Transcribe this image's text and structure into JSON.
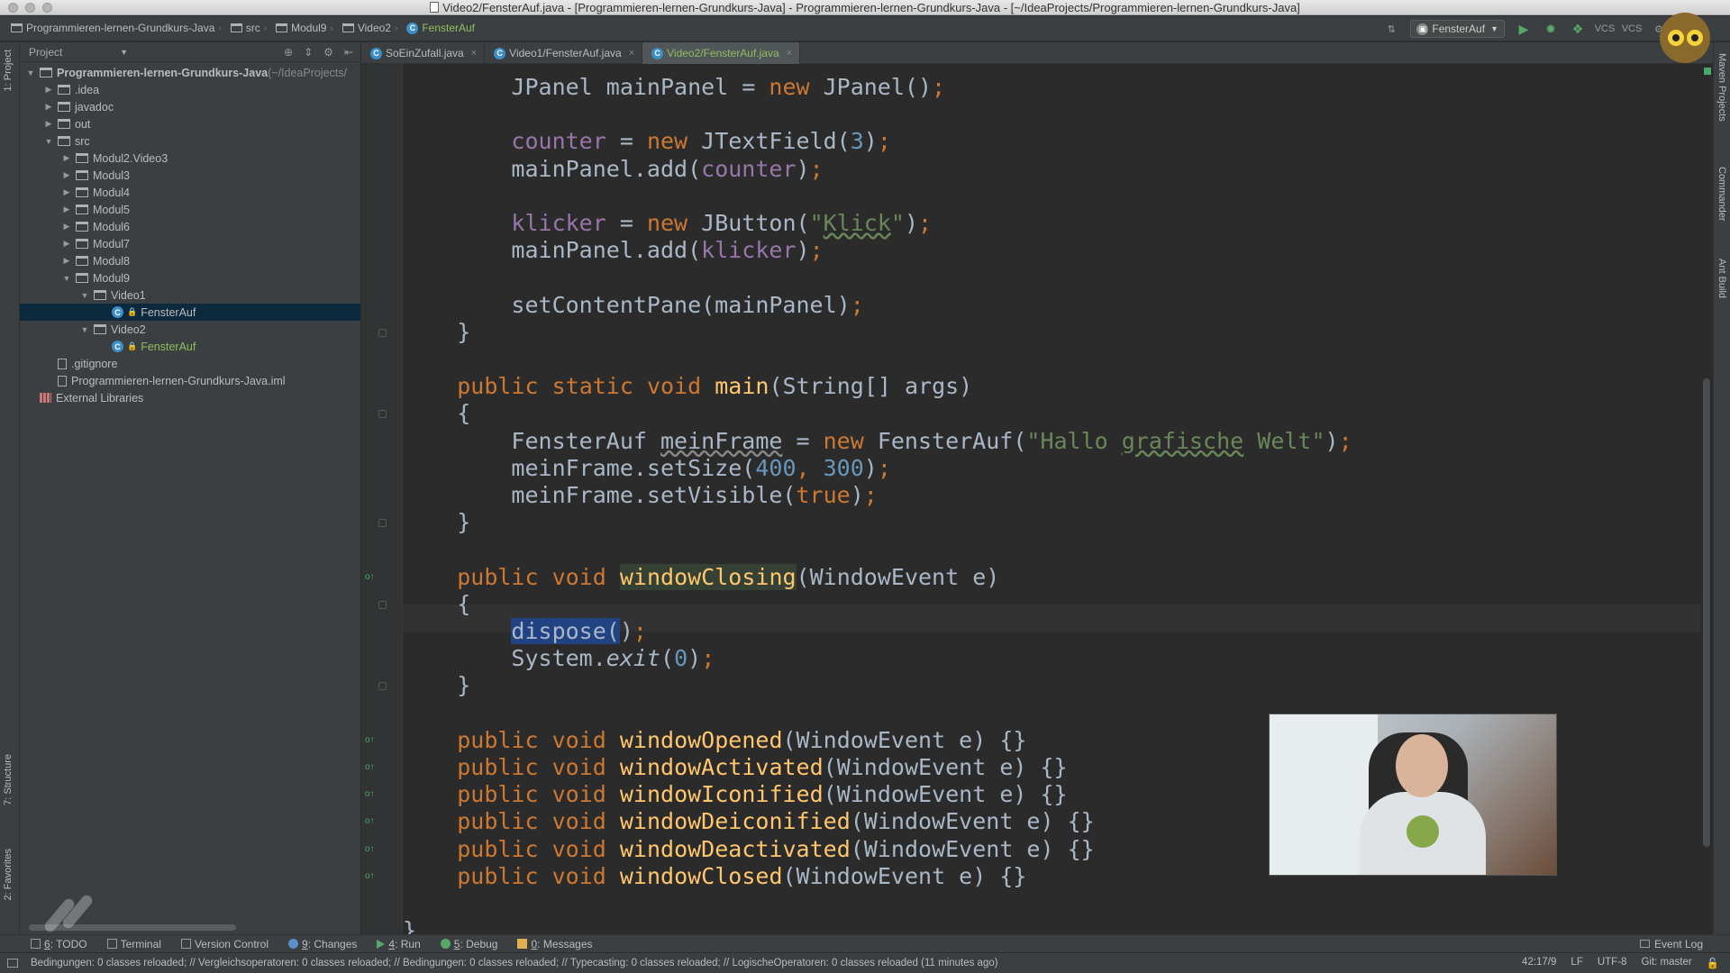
{
  "window": {
    "title": "Video2/FensterAuf.java - [Programmieren-lernen-Grundkurs-Java] - Programmieren-lernen-Grundkurs-Java - [~/IdeaProjects/Programmieren-lernen-Grundkurs-Java]"
  },
  "breadcrumbs": [
    "Programmieren-lernen-Grundkurs-Java",
    "src",
    "Modul9",
    "Video2",
    "FensterAuf"
  ],
  "toolbar": {
    "run_config": "FensterAuf",
    "vcs1": "VCS",
    "vcs2": "VCS"
  },
  "project_panel": {
    "header": "Project",
    "tree": [
      {
        "label": "Programmieren-lernen-Grundkurs-Java",
        "suffix": "(~/IdeaProjects/",
        "type": "project",
        "indent": 0,
        "expanded": true
      },
      {
        "label": ".idea",
        "type": "folder",
        "indent": 1,
        "expanded": false
      },
      {
        "label": "javadoc",
        "type": "folder",
        "indent": 1,
        "expanded": false
      },
      {
        "label": "out",
        "type": "folder",
        "indent": 1,
        "expanded": false
      },
      {
        "label": "src",
        "type": "folder",
        "indent": 1,
        "expanded": true
      },
      {
        "label": "Modul2.Video3",
        "type": "folder",
        "indent": 2,
        "expanded": false
      },
      {
        "label": "Modul3",
        "type": "folder",
        "indent": 2,
        "expanded": false
      },
      {
        "label": "Modul4",
        "type": "folder",
        "indent": 2,
        "expanded": false
      },
      {
        "label": "Modul5",
        "type": "folder",
        "indent": 2,
        "expanded": false
      },
      {
        "label": "Modul6",
        "type": "folder",
        "indent": 2,
        "expanded": false
      },
      {
        "label": "Modul7",
        "type": "folder",
        "indent": 2,
        "expanded": false
      },
      {
        "label": "Modul8",
        "type": "folder",
        "indent": 2,
        "expanded": false
      },
      {
        "label": "Modul9",
        "type": "folder",
        "indent": 2,
        "expanded": true
      },
      {
        "label": "Video1",
        "type": "folder",
        "indent": 3,
        "expanded": true
      },
      {
        "label": "FensterAuf",
        "type": "class",
        "indent": 4,
        "selected": true
      },
      {
        "label": "Video2",
        "type": "folder",
        "indent": 3,
        "expanded": true
      },
      {
        "label": "FensterAuf",
        "type": "class",
        "indent": 4,
        "green": true
      },
      {
        "label": ".gitignore",
        "type": "file",
        "indent": 1
      },
      {
        "label": "Programmieren-lernen-Grundkurs-Java.iml",
        "type": "file",
        "indent": 1
      },
      {
        "label": "External Libraries",
        "type": "library",
        "indent": 0
      }
    ]
  },
  "left_strip": {
    "project_tab": "1: Project",
    "structure_tab": "7: Structure",
    "favorites_tab": "2: Favorites"
  },
  "right_strip": {
    "maven": "Maven Projects",
    "commander": "Commander",
    "ant": "Ant Build"
  },
  "editor_tabs": [
    {
      "label": "SoEinZufall.java",
      "active": false
    },
    {
      "label": "Video1/FensterAuf.java",
      "active": false
    },
    {
      "label": "Video2/FensterAuf.java",
      "active": true
    }
  ],
  "code_lines": [
    "        JPanel mainPanel = new JPanel();",
    "",
    "        counter = new JTextField(3);",
    "        mainPanel.add(counter);",
    "",
    "        klicker = new JButton(\"Klick\");",
    "        mainPanel.add(klicker);",
    "",
    "        setContentPane(mainPanel);",
    "    }",
    "",
    "    public static void main(String[] args)",
    "    {",
    "        FensterAuf meinFrame = new FensterAuf(\"Hallo grafische Welt\");",
    "        meinFrame.setSize(400, 300);",
    "        meinFrame.setVisible(true);",
    "    }",
    "",
    "    public void windowClosing(WindowEvent e)",
    "    {",
    "        dispose();",
    "        System.exit(0);",
    "    }",
    "",
    "    public void windowOpened(WindowEvent e) {}",
    "    public void windowActivated(WindowEvent e) {}",
    "    public void windowIconified(WindowEvent e) {}",
    "    public void windowDeiconified(WindowEvent e) {}",
    "    public void windowDeactivated(WindowEvent e) {}",
    "    public void windowClosed(WindowEvent e) {}",
    "",
    "}"
  ],
  "bottom_tools": [
    {
      "label": "6: TODO",
      "icon": "todo-icon"
    },
    {
      "label": "Terminal",
      "icon": "terminal-icon"
    },
    {
      "label": "Version Control",
      "icon": "vcs-icon"
    },
    {
      "label": "9: Changes",
      "icon": "changes-icon"
    },
    {
      "label": "4: Run",
      "icon": "run-icon"
    },
    {
      "label": "5: Debug",
      "icon": "debug-icon"
    },
    {
      "label": "0: Messages",
      "icon": "messages-icon"
    }
  ],
  "event_log": "Event Log",
  "status": {
    "message": "Bedingungen: 0 classes reloaded; // Vergleichsoperatoren: 0 classes reloaded; // Bedingungen: 0 classes reloaded; // Typecasting: 0 classes reloaded; // LogischeOperatoren: 0 classes reloaded (11 minutes ago)",
    "position": "42:17/9",
    "line_sep": "LF",
    "encoding": "UTF-8",
    "git": "Git: master"
  }
}
